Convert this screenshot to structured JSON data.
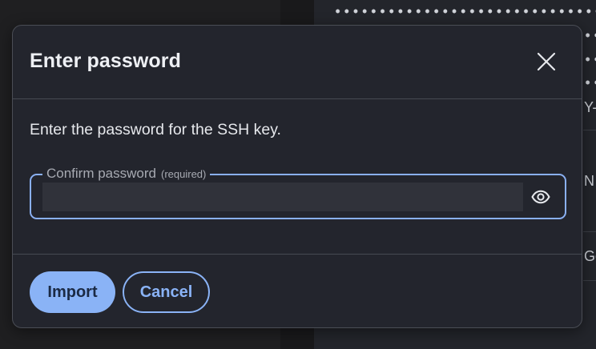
{
  "background": {
    "fragments": [
      "Y-",
      "N",
      "Go"
    ]
  },
  "dialog": {
    "title": "Enter password",
    "close_icon": "close-icon",
    "body_text": "Enter the password for the SSH key.",
    "field": {
      "label": "Confirm password",
      "required_label": "(required)",
      "value": "",
      "placeholder": "",
      "toggle_icon": "eye-icon"
    },
    "buttons": {
      "import_label": "Import",
      "cancel_label": "Cancel"
    }
  },
  "colors": {
    "accent": "#8ab3f6",
    "dialog_bg": "#23252d",
    "input_bg": "#30323a"
  }
}
